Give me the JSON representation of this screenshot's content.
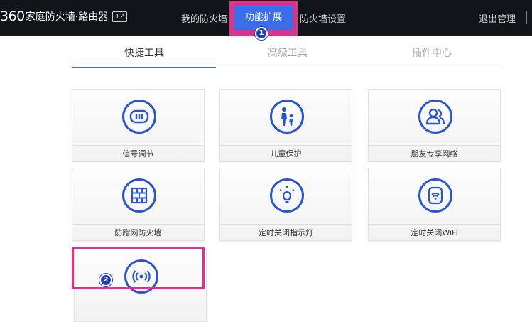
{
  "header": {
    "brand": "360",
    "product": "家庭防火墙·路由器",
    "model_badge": "T2",
    "nav": [
      {
        "label": "我的防火墙"
      },
      {
        "label": "功能扩展"
      },
      {
        "label": "防火墙设置"
      }
    ],
    "logout": "退出管理"
  },
  "markers": {
    "first": "1",
    "second": "2"
  },
  "tabs": [
    {
      "label": "快捷工具"
    },
    {
      "label": "高级工具"
    },
    {
      "label": "插件中心"
    }
  ],
  "tools": [
    {
      "label": "信号调节",
      "icon": "signal-adjust-icon"
    },
    {
      "label": "儿童保护",
      "icon": "child-protection-icon"
    },
    {
      "label": "朋友专享网络",
      "icon": "friends-network-icon"
    },
    {
      "label": "防蹭网防火墙",
      "icon": "anti-freeload-firewall-icon"
    },
    {
      "label": "定时关闭指示灯",
      "icon": "light-bulb-icon"
    },
    {
      "label": "定时关闭WiFi",
      "icon": "wifi-timer-icon"
    },
    {
      "label": "",
      "icon": "wireless-broadcast-icon"
    }
  ],
  "colors": {
    "accent": "#3a6ee8",
    "highlight": "#d7358c",
    "icon": "#2a55cc",
    "topbar": "#111418"
  }
}
